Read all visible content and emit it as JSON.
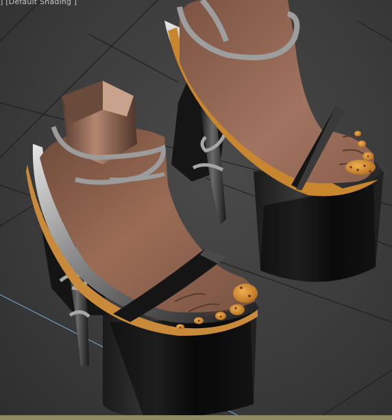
{
  "viewport": {
    "label": "] [Default Shading ]",
    "shading_mode": "Default Shading"
  },
  "scene": {
    "objects": [
      "left-platform-sandal",
      "right-platform-sandal",
      "left-foot",
      "right-foot"
    ],
    "colors": {
      "background": "#3c3c3c",
      "grid_line": "#1e1e1e",
      "grid_axis": "#7fb0d8",
      "sole": "#0d0d0d",
      "sole_rim": "#c98a3a",
      "strap": "#9a9a9a",
      "skin": "#8a5e48",
      "toenail": "#d08a2c",
      "bottom_strip": "#8f8a60"
    }
  }
}
